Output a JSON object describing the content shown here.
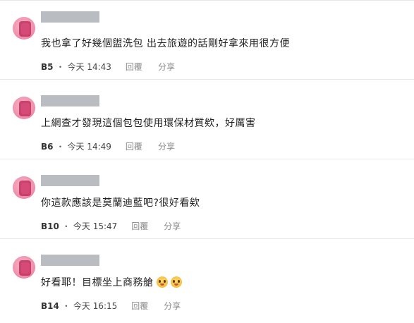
{
  "comments": [
    {
      "text": "我也拿了好幾個盥洗包 出去旅遊的話剛好拿來用很方便",
      "floor": "B5",
      "time": "今天 14:43",
      "reply_label": "回覆",
      "share_label": "分享",
      "emoji_count": 0
    },
    {
      "text": "上網查才發現這個包包使用環保材質欸，好厲害",
      "floor": "B6",
      "time": "今天 14:49",
      "reply_label": "回覆",
      "share_label": "分享",
      "emoji_count": 0
    },
    {
      "text": "你這款應該是莫蘭迪藍吧?很好看欸",
      "floor": "B10",
      "time": "今天 15:47",
      "reply_label": "回覆",
      "share_label": "分享",
      "emoji_count": 0
    },
    {
      "text": "好看耶！目標坐上商務艙",
      "floor": "B14",
      "time": "今天 16:15",
      "reply_label": "回覆",
      "share_label": "分享",
      "emoji_count": 2,
      "emoji_icon": "pleading-face-emoji"
    }
  ],
  "meta_separator": "・"
}
